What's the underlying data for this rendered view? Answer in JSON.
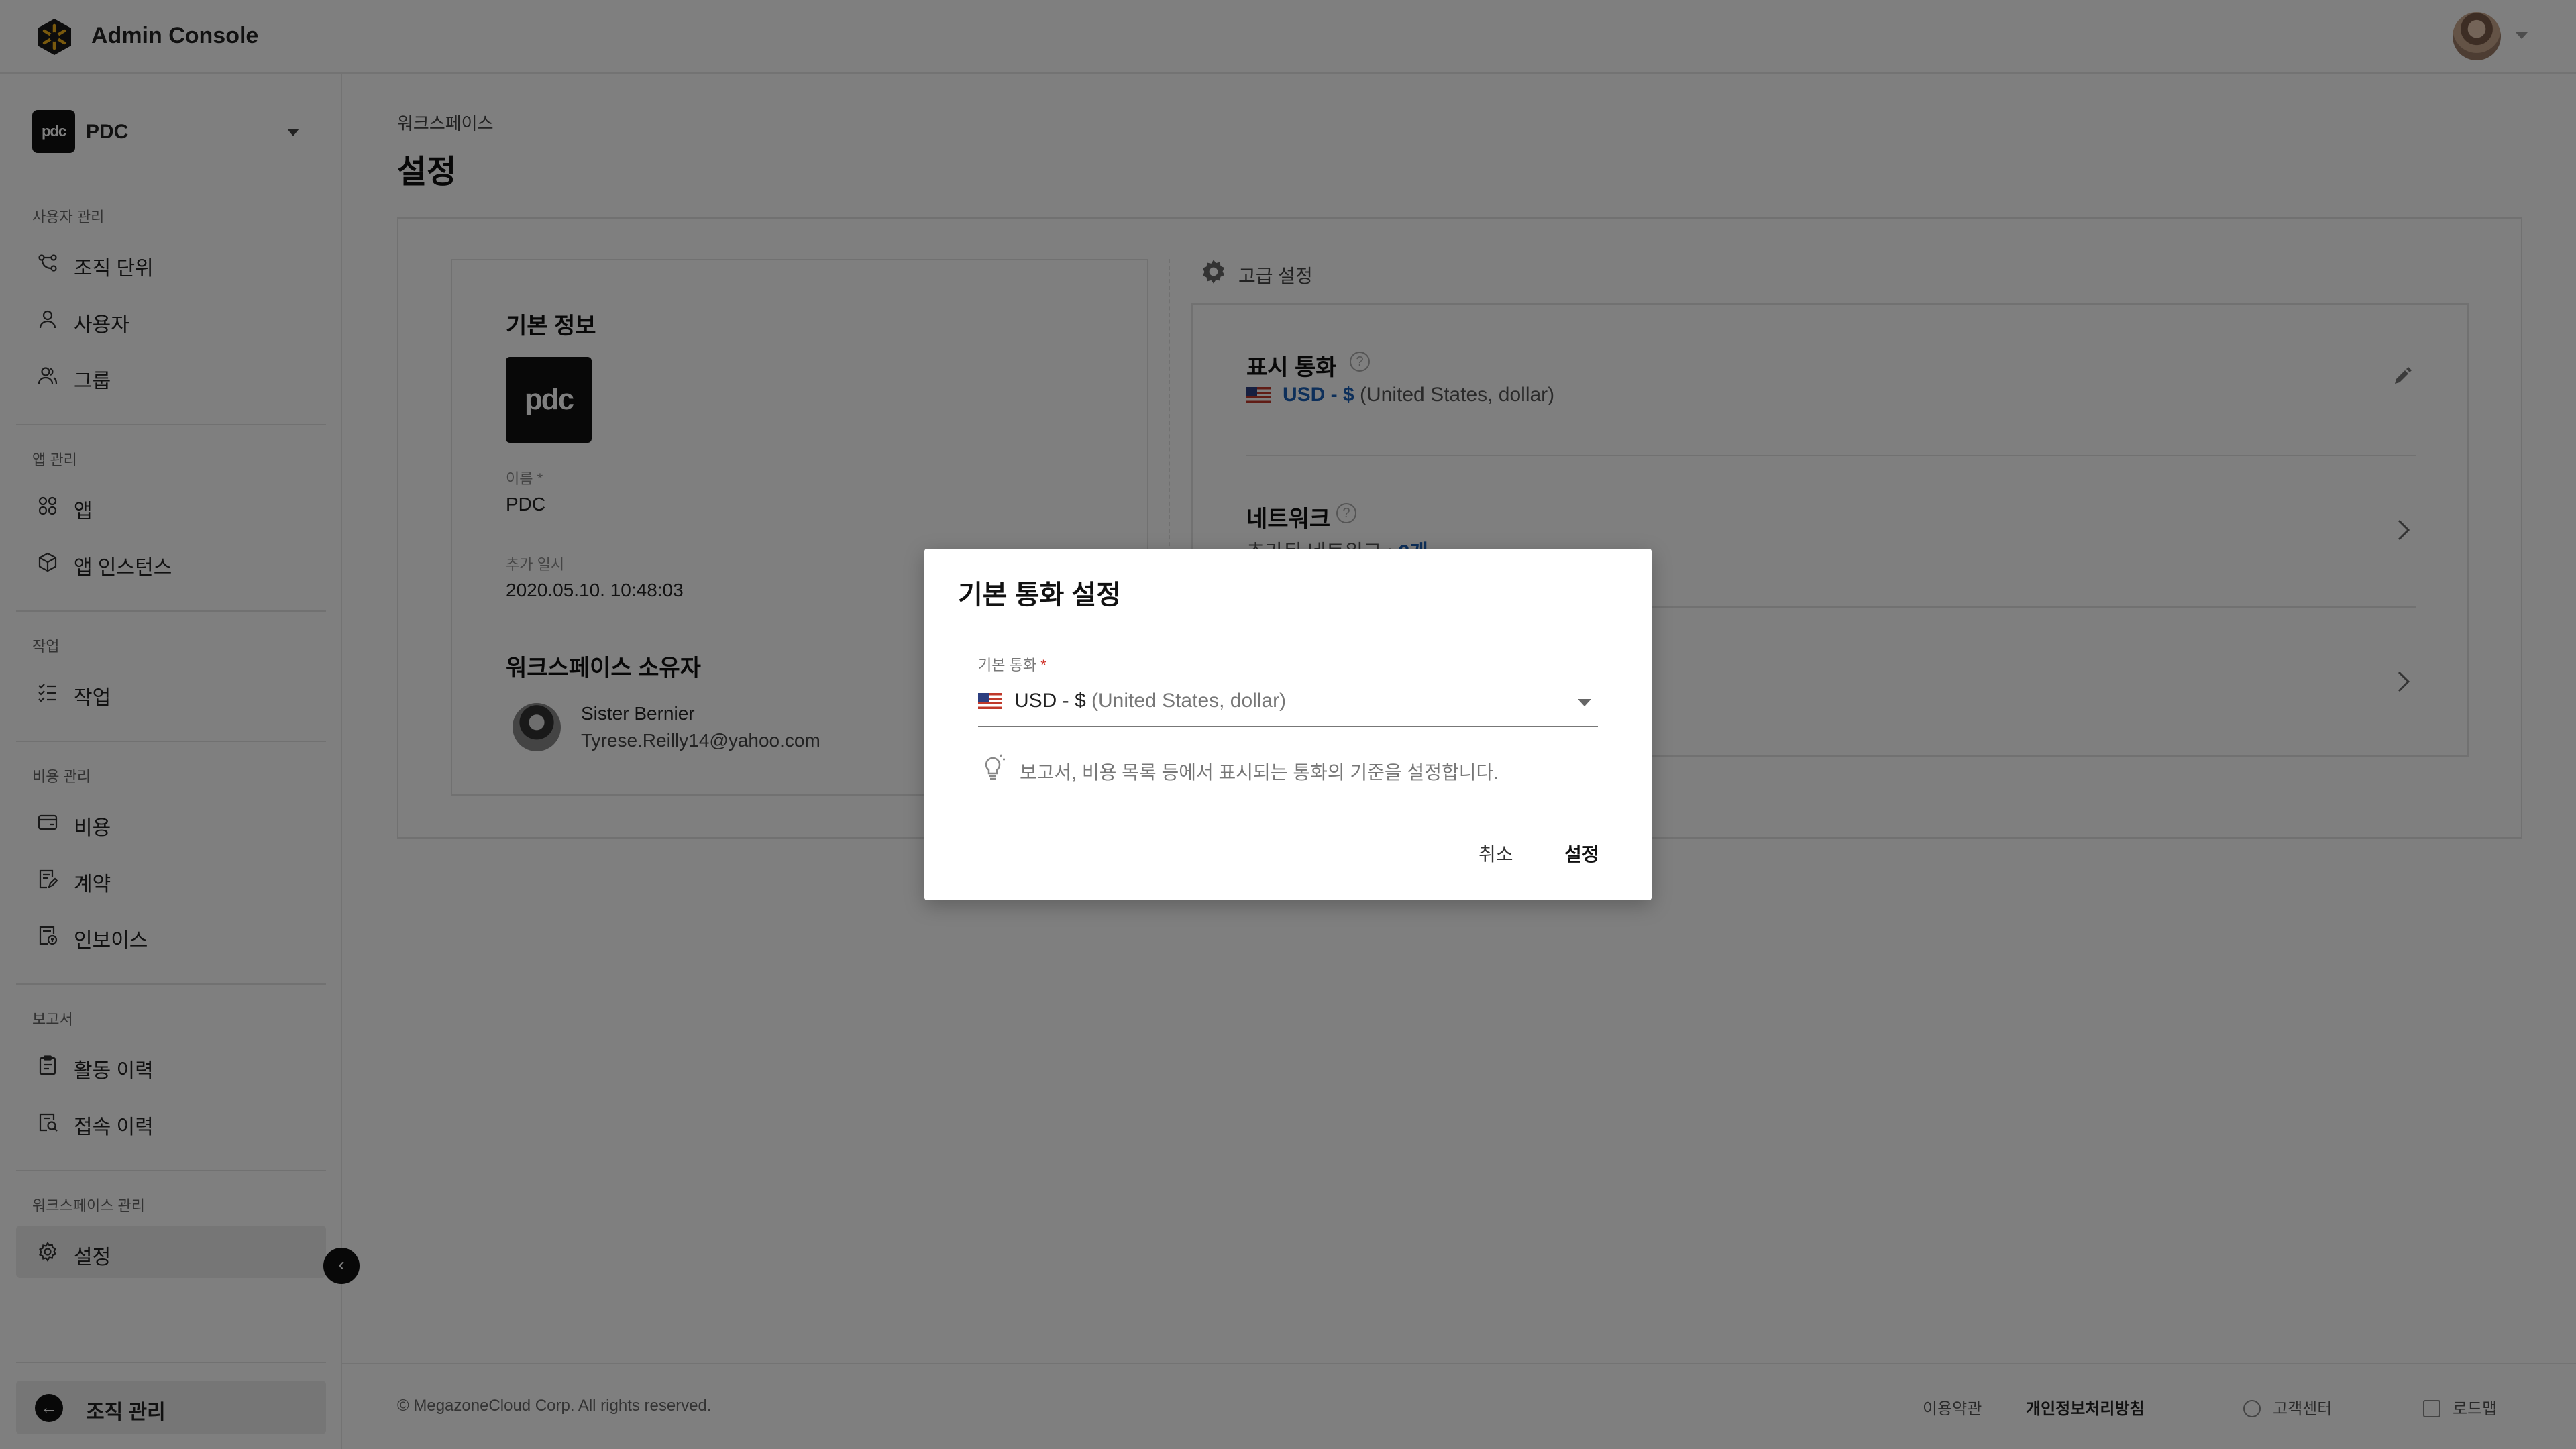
{
  "app": {
    "title": "Admin Console"
  },
  "workspace": {
    "name": "PDC",
    "logo_text": "pdc"
  },
  "sidebar": {
    "sections": [
      {
        "label": "사용자 관리",
        "items": [
          {
            "label": "조직 단위",
            "icon": "org-unit-icon"
          },
          {
            "label": "사용자",
            "icon": "user-icon"
          },
          {
            "label": "그룹",
            "icon": "group-icon"
          }
        ]
      },
      {
        "label": "앱 관리",
        "items": [
          {
            "label": "앱",
            "icon": "apps-grid-icon"
          },
          {
            "label": "앱 인스턴스",
            "icon": "cube-icon"
          }
        ]
      },
      {
        "label": "작업",
        "items": [
          {
            "label": "작업",
            "icon": "tasks-icon"
          }
        ]
      },
      {
        "label": "비용 관리",
        "items": [
          {
            "label": "비용",
            "icon": "wallet-icon"
          },
          {
            "label": "계약",
            "icon": "contract-icon"
          },
          {
            "label": "인보이스",
            "icon": "invoice-icon"
          }
        ]
      },
      {
        "label": "보고서",
        "items": [
          {
            "label": "활동 이력",
            "icon": "clipboard-icon"
          },
          {
            "label": "접속 이력",
            "icon": "access-log-icon"
          }
        ]
      },
      {
        "label": "워크스페이스 관리",
        "items": [
          {
            "label": "설정",
            "icon": "gear-icon",
            "active": true
          }
        ]
      }
    ],
    "org_button": "조직 관리"
  },
  "main": {
    "breadcrumb": "워크스페이스",
    "title": "설정",
    "basic": {
      "title": "기본 정보",
      "name_label": "이름 *",
      "name_value": "PDC",
      "added_label": "추가 일시",
      "added_value": "2020.05.10. 10:48:03",
      "owner_title": "워크스페이스 소유자",
      "owner_name": "Sister Bernier",
      "owner_email": "Tyrese.Reilly14@yahoo.com"
    },
    "advanced": {
      "title": "고급 설정",
      "currency_title": "표시 통화",
      "currency_code": "USD - $",
      "currency_desc": "(United States, dollar)",
      "network_title": "네트워크",
      "network_sub_partial": "추가된 네트워크 : ",
      "network_count": "2개"
    }
  },
  "footer": {
    "copyright": "© MegazoneCloud Corp. All rights reserved.",
    "terms": "이용약관",
    "privacy": "개인정보처리방침",
    "support": "고객센터",
    "roadmap": "로드맵"
  },
  "modal": {
    "title": "기본 통화 설정",
    "field_label": "기본 통화",
    "field_required": "*",
    "selected_code": "USD - $",
    "selected_desc": "(United States, dollar)",
    "hint": "보고서, 비용 목록 등에서 표시되는 통화의 기준을 설정합니다.",
    "cancel": "취소",
    "confirm": "설정"
  },
  "colors": {
    "accent": "#1a5fb4",
    "required": "#d0342c",
    "overlay": "rgba(0,0,0,0.5)"
  }
}
